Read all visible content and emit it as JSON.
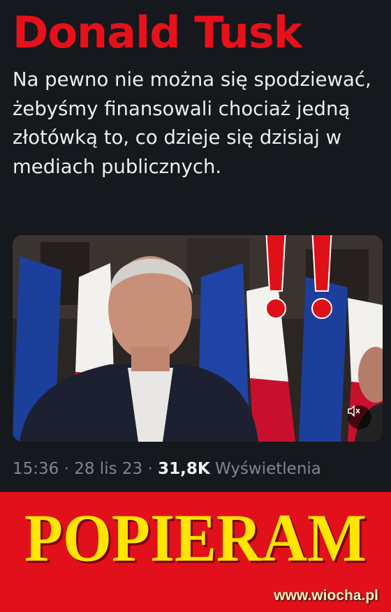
{
  "tweet": {
    "author_name": "Donald Tusk",
    "text": "Na pewno nie można się spodziewać, żebyśmy finansowali chociaż jedną złotówką to, co dzieje się dzisiaj w mediach publicznych.",
    "meta": {
      "time": "15:36",
      "separator": " · ",
      "date": "28 lis 23",
      "views_count": "31,8K",
      "views_label": "Wyświetlenia"
    },
    "media": {
      "type": "video",
      "mute_icon": "speaker-muted-icon",
      "overlay_icon": "double-exclamation-icon"
    }
  },
  "banner": {
    "slogan": "POPIERAM",
    "watermark": "www.wiocha.pl"
  },
  "colors": {
    "accent_red": "#e8101a",
    "banner_red": "#e2101b",
    "slogan_yellow": "#ffe600",
    "background": "#15181c",
    "meta_gray": "#7d8690"
  }
}
